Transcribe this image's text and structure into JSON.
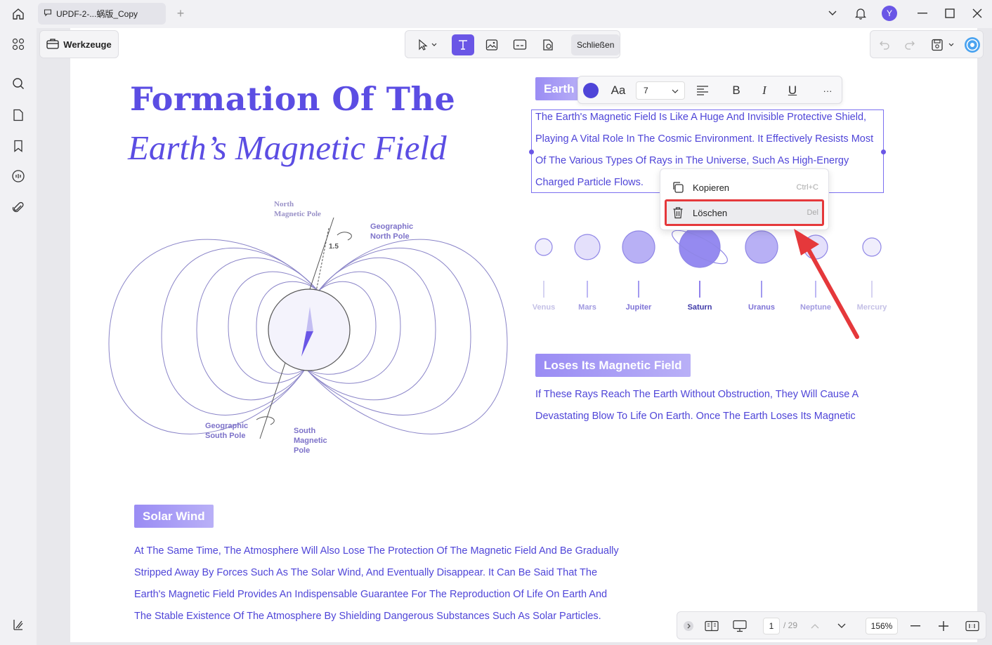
{
  "titlebar": {
    "tab_title": "UPDF-2-...蜗版_Copy",
    "avatar_letter": "Y"
  },
  "toolbar": {
    "tools_label": "Werkzeuge",
    "close_label": "Schließen"
  },
  "page": {
    "title_line1": "Formation Of The",
    "title_line2": "Earth’s Magnetic Field",
    "earth_badge": "Earth",
    "paragraph1": [
      "The Earth's Magnetic Field Is Like A Huge And Invisible Protective Shield,",
      "Playing A Vital Role In The Cosmic Environment. It Effectively Resists Most",
      "Of The Various Types Of Rays in The Universe, Such As High-Energy",
      "Charged Particle Flows."
    ],
    "loses_badge": "Loses Its Magnetic Field",
    "paragraph2": [
      "If These Rays Reach The Earth Without Obstruction, They Will Cause A",
      "Devastating Blow To Life On Earth. Once The Earth Loses Its Magnetic"
    ],
    "solar_badge": "Solar Wind",
    "paragraph3": [
      "At The Same Time, The Atmosphere Will Also Lose The Protection Of The Magnetic Field And Be Gradually",
      "Stripped Away By Forces Such As The Solar Wind, And Eventually Disappear. It Can Be Said That The",
      "Earth's Magnetic Field Provides An Indispensable Guarantee For The Reproduction Of Life On Earth And",
      "The Stable Existence Of The Atmosphere By Shielding Dangerous Substances Such As Solar Particles."
    ],
    "diagram": {
      "north_magnetic": [
        "North",
        "Magnetic Pole"
      ],
      "geo_north": [
        "Geographic",
        "North Pole"
      ],
      "angle": "1.5",
      "geo_south": [
        "Geographic",
        "South Pole"
      ],
      "south_magnetic": [
        "South",
        "Magnetic",
        "Pole"
      ]
    },
    "planets": [
      "Venus",
      "Mars",
      "Jupiter",
      "Saturn",
      "Uranus",
      "Neptune",
      "Mercury"
    ]
  },
  "format_bar": {
    "font_label": "Aa",
    "font_size": "7",
    "bold": "B",
    "italic": "I",
    "underline": "U",
    "more": "···"
  },
  "context_menu": {
    "copy_label": "Kopieren",
    "copy_shortcut": "Ctrl+C",
    "delete_label": "Löschen",
    "delete_shortcut": "Del"
  },
  "statusbar": {
    "current_page": "1",
    "total_pages": "/ 29",
    "zoom": "156%"
  },
  "colors": {
    "accent": "#6a56e6",
    "text_purple": "#4f45d8",
    "highlight_red": "#e5383b"
  }
}
